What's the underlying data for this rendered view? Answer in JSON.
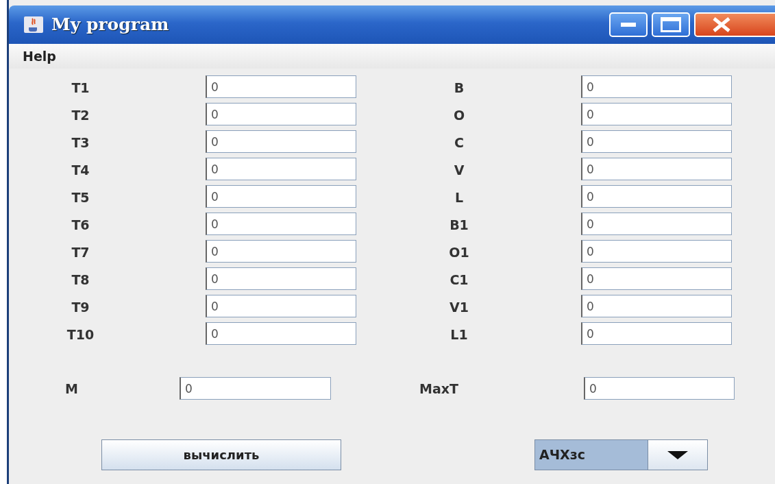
{
  "window": {
    "title": "My program"
  },
  "menu": [
    {
      "label": "Help"
    }
  ],
  "left_fields": [
    {
      "label": "T1",
      "value": "0"
    },
    {
      "label": "T2",
      "value": "0"
    },
    {
      "label": "T3",
      "value": "0"
    },
    {
      "label": "T4",
      "value": "0"
    },
    {
      "label": "T5",
      "value": "0"
    },
    {
      "label": "T6",
      "value": "0"
    },
    {
      "label": "T7",
      "value": "0"
    },
    {
      "label": "T8",
      "value": "0"
    },
    {
      "label": "T9",
      "value": "0"
    },
    {
      "label": "T10",
      "value": "0"
    }
  ],
  "right_fields": [
    {
      "label": "B",
      "value": "0"
    },
    {
      "label": "O",
      "value": "0"
    },
    {
      "label": "C",
      "value": "0"
    },
    {
      "label": "V",
      "value": "0"
    },
    {
      "label": "L",
      "value": "0"
    },
    {
      "label": "B1",
      "value": "0"
    },
    {
      "label": "O1",
      "value": "0"
    },
    {
      "label": "C1",
      "value": "0"
    },
    {
      "label": "V1",
      "value": "0"
    },
    {
      "label": "L1",
      "value": "0"
    }
  ],
  "result_fields": [
    {
      "label": "M",
      "value": "0"
    },
    {
      "label": "MaxT",
      "value": "0"
    }
  ],
  "calculate_button": {
    "label": "вычислить"
  },
  "mode_select": {
    "value": "АЧХзс"
  }
}
